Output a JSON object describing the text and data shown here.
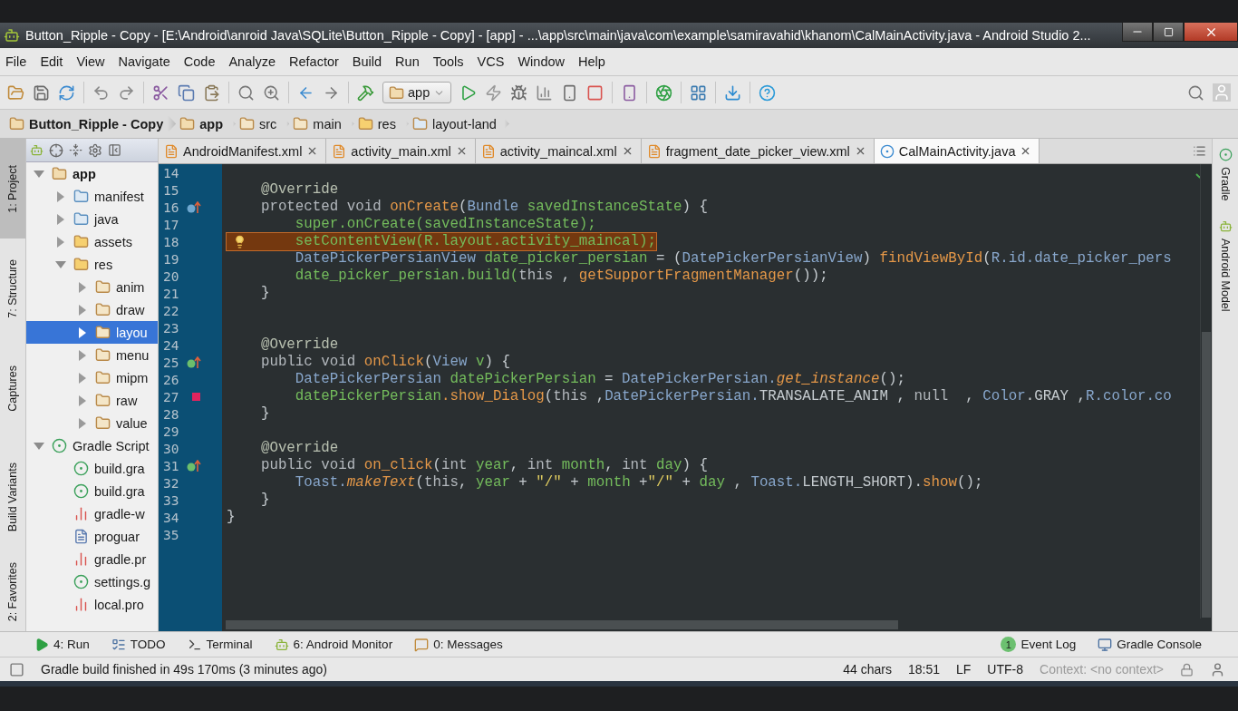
{
  "window": {
    "title": "Button_Ripple - Copy - [E:\\Android\\anroid Java\\SQLite\\Button_Ripple - Copy] - [app] - ...\\app\\src\\main\\java\\com\\example\\samiravahid\\khanom\\CalMainActivity.java - Android Studio 2..."
  },
  "menus": [
    "File",
    "Edit",
    "View",
    "Navigate",
    "Code",
    "Analyze",
    "Refactor",
    "Build",
    "Run",
    "Tools",
    "VCS",
    "Window",
    "Help"
  ],
  "toolbar": {
    "run_config": "app"
  },
  "breadcrumb": [
    {
      "label": "Button_Ripple - Copy",
      "kind": "project"
    },
    {
      "label": "app",
      "kind": "module"
    },
    {
      "label": "src",
      "kind": "folder"
    },
    {
      "label": "main",
      "kind": "folder"
    },
    {
      "label": "res",
      "kind": "res"
    },
    {
      "label": "layout-land",
      "kind": "layout"
    }
  ],
  "left_tool_tabs": [
    {
      "label": "1: Project",
      "selected": true
    },
    {
      "label": "7: Structure",
      "selected": false
    },
    {
      "label": "Captures",
      "selected": false
    },
    {
      "label": "Build Variants",
      "selected": false
    },
    {
      "label": "2: Favorites",
      "selected": false
    }
  ],
  "project_tree": [
    {
      "label": "app",
      "kind": "module",
      "expanded": true,
      "selected": false,
      "children": [
        {
          "label": "manifest",
          "kind": "folder-blue",
          "expanded": false,
          "selected": false
        },
        {
          "label": "java",
          "kind": "folder-blue",
          "expanded": false,
          "selected": false
        },
        {
          "label": "assets",
          "kind": "folder-res",
          "expanded": false,
          "selected": false
        },
        {
          "label": "res",
          "kind": "folder-res",
          "expanded": true,
          "selected": false,
          "children": [
            {
              "label": "anim",
              "kind": "folder",
              "expanded": false,
              "selected": false
            },
            {
              "label": "draw",
              "kind": "folder",
              "expanded": false,
              "selected": false
            },
            {
              "label": "layou",
              "kind": "folder",
              "expanded": false,
              "selected": true
            },
            {
              "label": "menu",
              "kind": "folder",
              "expanded": false,
              "selected": false
            },
            {
              "label": "mipm",
              "kind": "folder",
              "expanded": false,
              "selected": false
            },
            {
              "label": "raw",
              "kind": "folder",
              "expanded": false,
              "selected": false
            },
            {
              "label": "value",
              "kind": "folder",
              "expanded": false,
              "selected": false
            }
          ]
        }
      ]
    },
    {
      "label": "Gradle Script",
      "kind": "gradle",
      "expanded": true,
      "selected": false,
      "children": [
        {
          "label": "build.gra",
          "kind": "gradle",
          "selected": false
        },
        {
          "label": "build.gra",
          "kind": "gradle",
          "selected": false
        },
        {
          "label": "gradle-w",
          "kind": "props",
          "selected": false
        },
        {
          "label": "proguar",
          "kind": "file",
          "selected": false
        },
        {
          "label": "gradle.pr",
          "kind": "props",
          "selected": false
        },
        {
          "label": "settings.g",
          "kind": "gradle",
          "selected": false
        },
        {
          "label": "local.pro",
          "kind": "props",
          "selected": false
        }
      ]
    }
  ],
  "editor": {
    "tabs": [
      {
        "label": "AndroidManifest.xml",
        "kind": "xml",
        "selected": false
      },
      {
        "label": "activity_main.xml",
        "kind": "xml",
        "selected": false
      },
      {
        "label": "activity_maincal.xml",
        "kind": "xml",
        "selected": false
      },
      {
        "label": "fragment_date_picker_view.xml",
        "kind": "xml",
        "selected": false
      },
      {
        "label": "CalMainActivity.java",
        "kind": "java",
        "selected": true
      }
    ],
    "lines": [
      {
        "number": "14",
        "highlighted": false
      },
      {
        "number": "15",
        "highlighted": false,
        "tokens": [
          {
            "kind": "ann",
            "text": "    @Override"
          }
        ]
      },
      {
        "number": "16",
        "highlighted": false,
        "gutter": {
          "kind": "override"
        },
        "tokens": [
          {
            "kind": "kw",
            "text": "    protected void "
          },
          {
            "kind": "method",
            "text": "onCreate"
          },
          {
            "kind": "plain",
            "text": "("
          },
          {
            "kind": "type",
            "text": "Bundle "
          },
          {
            "kind": "var",
            "text": "savedInstanceState"
          },
          {
            "kind": "plain",
            "text": ") {"
          }
        ]
      },
      {
        "number": "17",
        "highlighted": false,
        "tokens": [
          {
            "kind": "var",
            "text": "        super.onCreate(savedInstanceState);"
          }
        ]
      },
      {
        "number": "18",
        "highlighted": true,
        "gutter": {
          "kind": "bulb"
        },
        "tokens": [
          {
            "kind": "var",
            "text": "        setContentView(R.layout.activity_maincal);"
          }
        ]
      },
      {
        "number": "19",
        "highlighted": false,
        "tokens": [
          {
            "kind": "type",
            "text": "        DatePickerPersianView "
          },
          {
            "kind": "var",
            "text": "date_picker_persian"
          },
          {
            "kind": "plain",
            "text": " = ("
          },
          {
            "kind": "type",
            "text": "DatePickerPersianView"
          },
          {
            "kind": "plain",
            "text": ") "
          },
          {
            "kind": "method",
            "text": "findViewById"
          },
          {
            "kind": "plain",
            "text": "("
          },
          {
            "kind": "type",
            "text": "R.id.date_picker_pers"
          }
        ]
      },
      {
        "number": "20",
        "highlighted": false,
        "tokens": [
          {
            "kind": "var",
            "text": "        date_picker_persian.build("
          },
          {
            "kind": "kw",
            "text": "this"
          },
          {
            "kind": "plain",
            "text": " , "
          },
          {
            "kind": "method",
            "text": "getSupportFragmentManager"
          },
          {
            "kind": "plain",
            "text": "());"
          }
        ]
      },
      {
        "number": "21",
        "highlighted": false,
        "tokens": [
          {
            "kind": "plain",
            "text": "    }"
          }
        ]
      },
      {
        "number": "22",
        "highlighted": false
      },
      {
        "number": "23",
        "highlighted": false
      },
      {
        "number": "24",
        "highlighted": false,
        "tokens": [
          {
            "kind": "ann",
            "text": "    @Override"
          }
        ]
      },
      {
        "number": "25",
        "highlighted": false,
        "gutter": {
          "kind": "implements"
        },
        "tokens": [
          {
            "kind": "kw",
            "text": "    public void "
          },
          {
            "kind": "method",
            "text": "onClick"
          },
          {
            "kind": "plain",
            "text": "("
          },
          {
            "kind": "type",
            "text": "View "
          },
          {
            "kind": "var",
            "text": "v"
          },
          {
            "kind": "plain",
            "text": ") {"
          }
        ]
      },
      {
        "number": "26",
        "highlighted": false,
        "tokens": [
          {
            "kind": "type",
            "text": "        DatePickerPersian "
          },
          {
            "kind": "var",
            "text": "datePickerPersian"
          },
          {
            "kind": "plain",
            "text": " = "
          },
          {
            "kind": "type",
            "text": "DatePickerPersian."
          },
          {
            "kind": "italic",
            "text": "get_instance"
          },
          {
            "kind": "plain",
            "text": "();"
          }
        ]
      },
      {
        "number": "27",
        "highlighted": false,
        "gutter": {
          "kind": "breakpoint"
        },
        "tokens": [
          {
            "kind": "var",
            "text": "        datePickerPersian"
          },
          {
            "kind": "method",
            "text": ".show_Dialog"
          },
          {
            "kind": "plain",
            "text": "("
          },
          {
            "kind": "kw",
            "text": "this"
          },
          {
            "kind": "plain",
            "text": " ,"
          },
          {
            "kind": "type",
            "text": "DatePickerPersian."
          },
          {
            "kind": "plain",
            "text": "TRANSALATE_ANIM , "
          },
          {
            "kind": "kw",
            "text": "null"
          },
          {
            "kind": "plain",
            "text": "  , "
          },
          {
            "kind": "type",
            "text": "Color"
          },
          {
            "kind": "plain",
            "text": ".GRAY ,"
          },
          {
            "kind": "type",
            "text": "R.color.co"
          }
        ]
      },
      {
        "number": "28",
        "highlighted": false,
        "tokens": [
          {
            "kind": "plain",
            "text": "    }"
          }
        ]
      },
      {
        "number": "29",
        "highlighted": false
      },
      {
        "number": "30",
        "highlighted": false,
        "tokens": [
          {
            "kind": "ann",
            "text": "    @Override"
          }
        ]
      },
      {
        "number": "31",
        "highlighted": false,
        "gutter": {
          "kind": "implements"
        },
        "tokens": [
          {
            "kind": "kw",
            "text": "    public void "
          },
          {
            "kind": "method",
            "text": "on_click"
          },
          {
            "kind": "plain",
            "text": "("
          },
          {
            "kind": "kw",
            "text": "int "
          },
          {
            "kind": "var",
            "text": "year"
          },
          {
            "kind": "plain",
            "text": ", "
          },
          {
            "kind": "kw",
            "text": "int "
          },
          {
            "kind": "var",
            "text": "month"
          },
          {
            "kind": "plain",
            "text": ", "
          },
          {
            "kind": "kw",
            "text": "int "
          },
          {
            "kind": "var",
            "text": "day"
          },
          {
            "kind": "plain",
            "text": ") {"
          }
        ]
      },
      {
        "number": "32",
        "highlighted": false,
        "tokens": [
          {
            "kind": "type",
            "text": "        Toast."
          },
          {
            "kind": "italic",
            "text": "makeText"
          },
          {
            "kind": "plain",
            "text": "("
          },
          {
            "kind": "kw",
            "text": "this"
          },
          {
            "kind": "plain",
            "text": ", "
          },
          {
            "kind": "var",
            "text": "year"
          },
          {
            "kind": "plain",
            "text": " + "
          },
          {
            "kind": "str",
            "text": "\"/\""
          },
          {
            "kind": "plain",
            "text": " + "
          },
          {
            "kind": "var",
            "text": "month"
          },
          {
            "kind": "plain",
            "text": " +"
          },
          {
            "kind": "str",
            "text": "\"/\""
          },
          {
            "kind": "plain",
            "text": " + "
          },
          {
            "kind": "var",
            "text": "day"
          },
          {
            "kind": "plain",
            "text": " , "
          },
          {
            "kind": "type",
            "text": "Toast."
          },
          {
            "kind": "plain",
            "text": "LENGTH_SHORT)."
          },
          {
            "kind": "method",
            "text": "show"
          },
          {
            "kind": "plain",
            "text": "();"
          }
        ]
      },
      {
        "number": "33",
        "highlighted": false,
        "tokens": [
          {
            "kind": "plain",
            "text": "    }"
          }
        ]
      },
      {
        "number": "34",
        "highlighted": false,
        "tokens": [
          {
            "kind": "plain",
            "text": "}"
          }
        ]
      },
      {
        "number": "35",
        "highlighted": false
      }
    ]
  },
  "right_tool_tabs": [
    {
      "label": "Gradle",
      "kind": "gradle"
    },
    {
      "label": "Android Model",
      "kind": "android"
    }
  ],
  "bottom_tools": {
    "left": [
      {
        "label": "4: Run",
        "kind": "run"
      },
      {
        "label": "TODO",
        "kind": "todo"
      },
      {
        "label": "Terminal",
        "kind": "terminal"
      },
      {
        "label": "6: Android Monitor",
        "kind": "android"
      },
      {
        "label": "0: Messages",
        "kind": "messages"
      }
    ],
    "right": [
      {
        "label": "Event Log",
        "kind": "event",
        "badge": "1"
      },
      {
        "label": "Gradle Console",
        "kind": "console"
      }
    ]
  },
  "status": {
    "message": "Gradle build finished in 49s 170ms (3 minutes ago)",
    "chars": "44 chars",
    "position": "18:51",
    "line_separator": "LF",
    "encoding": "UTF-8",
    "context": "Context: <no context>"
  }
}
